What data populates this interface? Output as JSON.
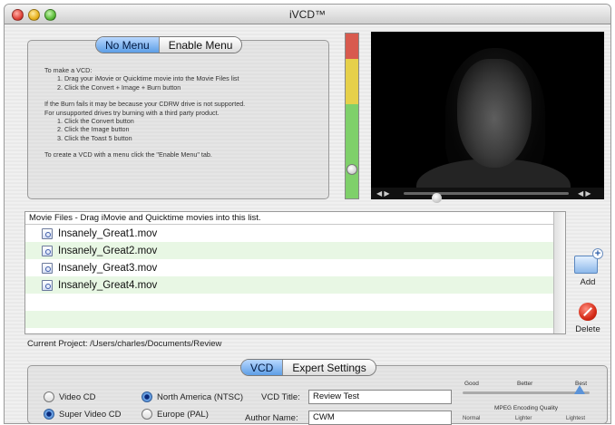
{
  "window": {
    "title": "iVCD™"
  },
  "menu_tabs": {
    "no_menu": "No Menu",
    "enable_menu": "Enable Menu"
  },
  "instructions": {
    "line1": "To make a VCD:",
    "line2": "1. Drag your iMovie or Quicktime movie into the Movie Files list",
    "line3": "2. Click the Convert + Image + Burn button",
    "line4": "If the Burn fails it may be because your CDRW drive is not  supported.",
    "line5": "For unsupported drives try burning with a third party product.",
    "line6": "1. Click the Convert button",
    "line7": "2. Click the Image button",
    "line8": "3. Click the Toast 5 button",
    "line9": "To create a VCD with a menu click the \"Enable Menu\" tab."
  },
  "player": {
    "prev": "◀ ▶",
    "next": "◀ ▶",
    "progress": 0.18
  },
  "movie_files": {
    "header": "Movie Files - Drag iMovie and Quicktime movies into this list.",
    "files": [
      "Insanely_Great1.mov",
      "Insanely_Great2.mov",
      "Insanely_Great3.mov",
      "Insanely_Great4.mov"
    ]
  },
  "side_buttons": {
    "add": "Add",
    "delete": "Delete"
  },
  "project": {
    "label": "Current Project:",
    "path": "/Users/charles/Documents/Review"
  },
  "settings_tabs": {
    "vcd": "VCD",
    "expert": "Expert Settings"
  },
  "format": {
    "video_cd": "Video CD",
    "super_video_cd": "Super Video CD",
    "selected": "Super Video CD"
  },
  "region": {
    "ntsc": "North America (NTSC)",
    "pal": "Europe (PAL)",
    "selected": "North America (NTSC)"
  },
  "fields": {
    "title_label": "VCD Title:",
    "title_value": "Review Test",
    "author_label": "Author Name:",
    "author_value": "CWM"
  },
  "quality": {
    "good": "Good",
    "better": "Better",
    "best": "Best",
    "caption": "MPEG Encoding Quality",
    "normal": "Normal",
    "lighter": "Lighter",
    "lightest": "Lightest",
    "level": 0.92
  },
  "colors": {
    "accent": "#5d9ee6",
    "row_alt": "#e8f7e4",
    "meter_red": "#d85a4e",
    "meter_yellow": "#e6d04a",
    "meter_green": "#7fd06a"
  }
}
